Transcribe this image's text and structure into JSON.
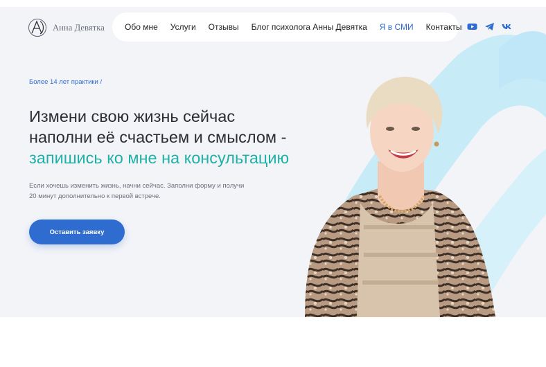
{
  "header": {
    "logo_name": "Анна Девятка",
    "nav": [
      {
        "label": "Обо мне",
        "active": false
      },
      {
        "label": "Услуги",
        "active": false
      },
      {
        "label": "Отзывы",
        "active": false
      },
      {
        "label": "Блог психолога Анны Девятка",
        "active": false
      },
      {
        "label": "Я в СМИ",
        "active": true
      },
      {
        "label": "Контакты",
        "active": false
      }
    ],
    "socials": [
      "youtube-icon",
      "telegram-icon",
      "vk-icon"
    ]
  },
  "hero": {
    "kicker": "Более 14 лет практики /",
    "headline_line1": "Измени свою жизнь сейчас",
    "headline_line2": "наполни её счастьем и смыслом -",
    "headline_accent": "запишись ко мне на консультацию",
    "description": "Если хочешь изменить жизнь, начни сейчас. Заполни форму и получи 20 минут дополнительно к первой встрече.",
    "cta_label": "Оставить заявку"
  },
  "colors": {
    "accent_blue": "#2e6cd0",
    "accent_teal": "#1fb0a7",
    "hero_background": "#f3f4f8",
    "brush_stroke": "#c8ebf8"
  }
}
